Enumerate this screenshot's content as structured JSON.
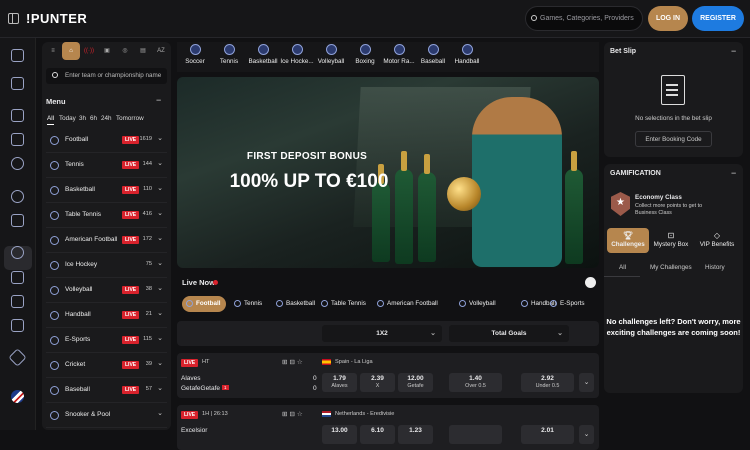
{
  "header": {
    "logo": "PUNTER",
    "search_placeholder": "Games, Categories, Providers",
    "login_label": "LOG IN",
    "register_label": "REGISTER"
  },
  "left_rail": {
    "icons": [
      "casino-icon",
      "home-icon",
      "betslip-icon",
      "promotions-icon",
      "sports-icon",
      "live-icon",
      "rewards-icon",
      "jackpot-icon",
      "tournaments-icon",
      "mobile-icon",
      "vip-icon",
      "language-flag-icon"
    ]
  },
  "menu": {
    "top_tabs": [
      "list-icon",
      "favorites-icon",
      "live-icon",
      "schedule-icon",
      "results-icon",
      "stats-icon",
      "A-Z"
    ],
    "az_label": "AZ",
    "search_placeholder": "Enter team or championship name",
    "title": "Menu",
    "filters": [
      "All",
      "Today",
      "3h",
      "6h",
      "24h",
      "Tomorrow"
    ],
    "sports": [
      {
        "name": "Football",
        "live": "LIVE",
        "count": "1619"
      },
      {
        "name": "Tennis",
        "live": "LIVE",
        "count": "144"
      },
      {
        "name": "Basketball",
        "live": "LIVE",
        "count": "110"
      },
      {
        "name": "Table Tennis",
        "live": "LIVE",
        "count": "416"
      },
      {
        "name": "American Football",
        "live": "LIVE",
        "count": "172"
      },
      {
        "name": "Ice Hockey",
        "live": "",
        "count": "75"
      },
      {
        "name": "Volleyball",
        "live": "LIVE",
        "count": "38"
      },
      {
        "name": "Handball",
        "live": "LIVE",
        "count": "21"
      },
      {
        "name": "E-Sports",
        "live": "LIVE",
        "count": "115"
      },
      {
        "name": "Cricket",
        "live": "LIVE",
        "count": "39"
      },
      {
        "name": "Baseball",
        "live": "LIVE",
        "count": "57"
      },
      {
        "name": "Snooker & Pool",
        "live": "",
        "count": ""
      }
    ]
  },
  "sports_strip": [
    "Soccer",
    "Tennis",
    "Basketball",
    "Ice Hocke...",
    "Volleyball",
    "Boxing",
    "Motor Ra...",
    "Baseball",
    "Handball"
  ],
  "banner": {
    "subtitle": "FIRST DEPOSIT BONUS",
    "headline": "100% UP TO €100"
  },
  "live_now": {
    "title": "Live Now",
    "filters": [
      "Football",
      "Tennis",
      "Basketball",
      "Table Tennis",
      "American Football",
      "Volleyball",
      "Handball",
      "E-Sports"
    ],
    "markets": [
      "1X2",
      "Total Goals"
    ],
    "matches": [
      {
        "status": "LIVE",
        "time": "HT",
        "league": "Spain - La Liga",
        "team1": "Alaves",
        "team2": "Getafe",
        "red_card": "1",
        "score1": "0",
        "score2": "0",
        "odds": [
          {
            "v": "1.79",
            "l": "Alaves"
          },
          {
            "v": "2.39",
            "l": "X"
          },
          {
            "v": "12.00",
            "l": "Getafe"
          },
          {
            "v": "1.40",
            "l": "Over 0.5"
          },
          {
            "v": "2.92",
            "l": "Under 0.5"
          }
        ]
      },
      {
        "status": "LIVE",
        "time": "1H | 26:13",
        "league": "Netherlands - Eredivisie",
        "team1": "Excelsior",
        "team2": "",
        "red_card": "",
        "score1": "",
        "score2": "",
        "odds": [
          {
            "v": "13.00",
            "l": ""
          },
          {
            "v": "6.10",
            "l": ""
          },
          {
            "v": "1.23",
            "l": ""
          },
          {
            "v": "",
            "l": ""
          },
          {
            "v": "2.01",
            "l": ""
          }
        ]
      }
    ]
  },
  "betslip": {
    "title": "Bet Slip",
    "empty_text": "No selections in the bet slip",
    "booking_label": "Enter Booking Code"
  },
  "gamification": {
    "title": "GAMIFICATION",
    "level": "Economy Class",
    "level_desc": "Collect more points to get to Business Class",
    "tabs": [
      "Challenges",
      "Mystery Box",
      "VIP Benefits"
    ],
    "subtabs": [
      "All",
      "My Challenges",
      "History"
    ],
    "empty_text": "No challenges left? Don't worry, more exciting challenges are coming soon!"
  }
}
